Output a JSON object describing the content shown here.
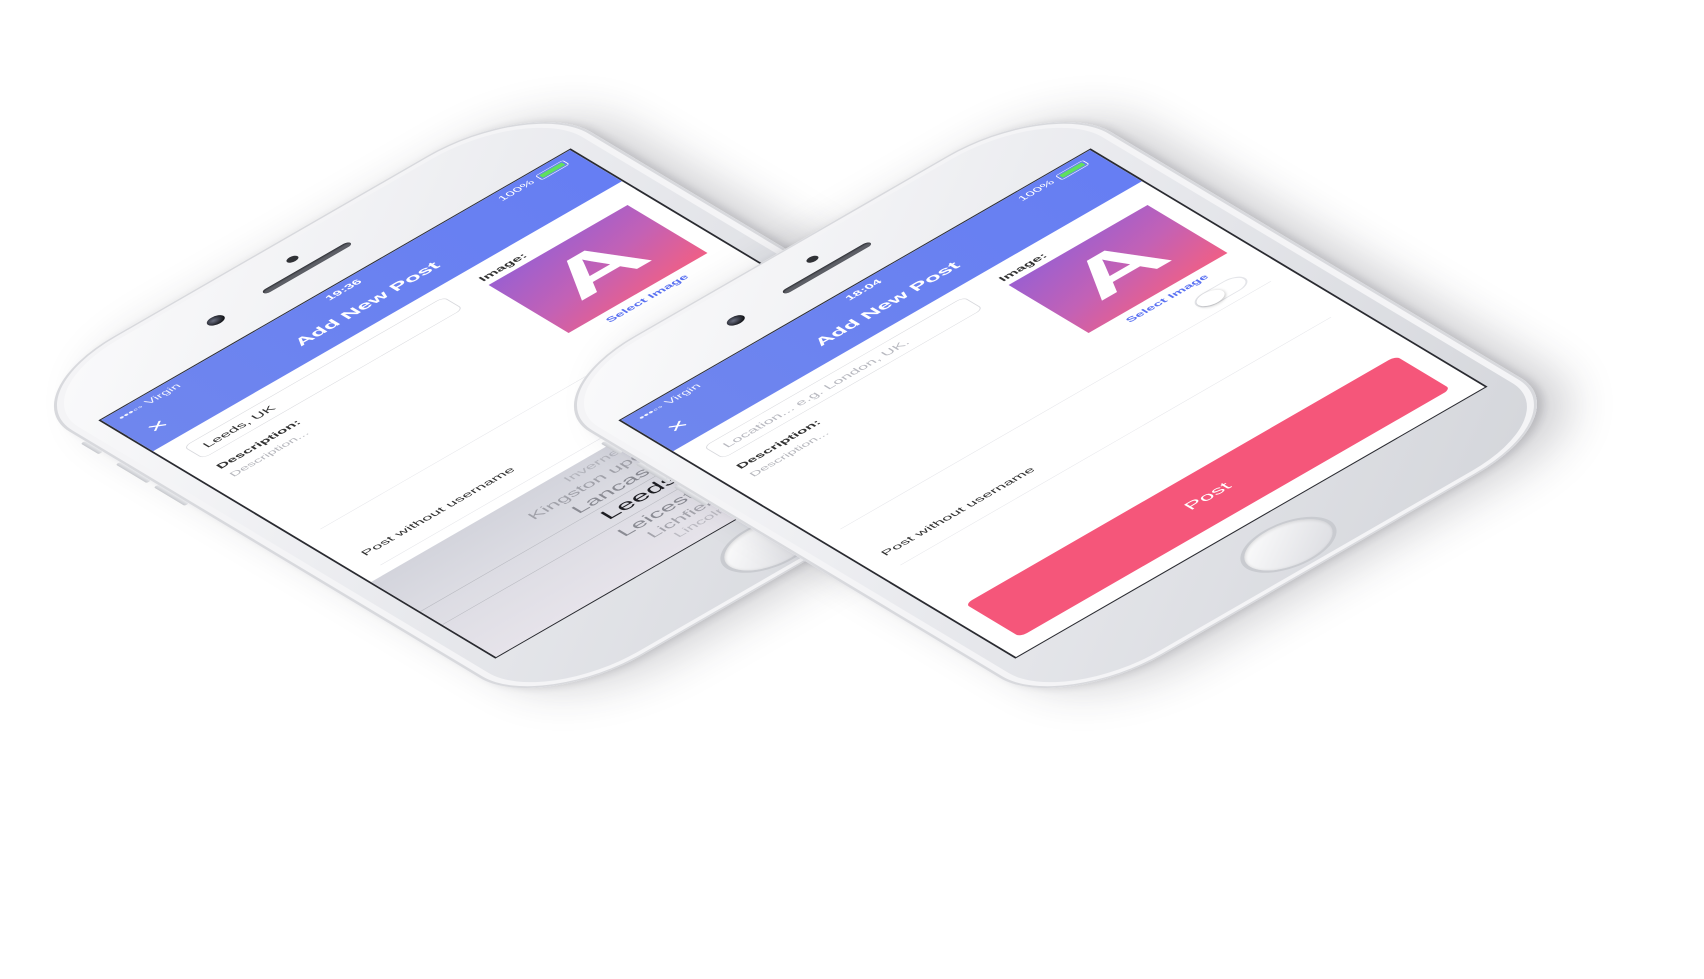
{
  "common": {
    "carrier": "•••◦◦ Virgin",
    "battery": "100%",
    "title": "Add New Post",
    "close_glyph": "×",
    "description_label": "Description:",
    "description_placeholder": "Description...",
    "image_label": "Image:",
    "image_letter": "A",
    "select_image": "Select Image",
    "anonymous_label": "Post without username"
  },
  "left_phone": {
    "time": "19:36",
    "location_value": "Leeds, UK",
    "picker": {
      "options": [
        "Inverness, UK",
        "Kingston upon Hull, UK",
        "Lancaster, UK",
        "Leeds, UK",
        "Leicester, UK",
        "Lichfield, UK",
        "Lincoln, UK"
      ],
      "selected": "Leeds, UK"
    }
  },
  "right_phone": {
    "time": "18:04",
    "location_placeholder": "Location... e.g. London, UK.",
    "post_button": "Post",
    "anonymous_toggle_on": false
  },
  "colors": {
    "nav": "#667ef3",
    "accent": "#5b72f2",
    "post_button": "#f5567a"
  }
}
